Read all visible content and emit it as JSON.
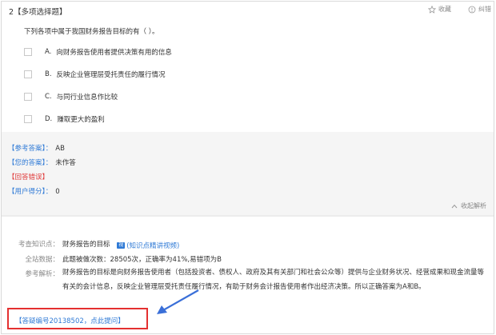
{
  "question": {
    "title": "2【多项选择题】",
    "stem": "下列各项中属于我国财务报告目标的有（  ）。",
    "favorite_label": "收藏",
    "report_error_label": "纠错",
    "options": [
      {
        "letter": "A.",
        "text": "向财务报告使用者提供决策有用的信息"
      },
      {
        "letter": "B.",
        "text": "反映企业管理层受托责任的履行情况"
      },
      {
        "letter": "C.",
        "text": "与同行业信息作比较"
      },
      {
        "letter": "D.",
        "text": "赚取更大的盈利"
      }
    ]
  },
  "answer": {
    "reference_label": "【参考答案】：",
    "reference_value": "AB",
    "yours_label": "【您的答案】：",
    "yours_value": "未作答",
    "wrong_label": "【回答错误】",
    "score_label": "【用户得分】：",
    "score_value": "0",
    "collapse_label": "收起解析"
  },
  "analysis": {
    "knowledge_label": "考查知识点：",
    "knowledge_value": "财务报告的目标",
    "video_badge": "视",
    "video_link": "(知识点精讲视频)",
    "stats_label": "全站数据：",
    "stats_value": "此题被做次数：28505次，正确率为41%,易错项为B",
    "explain_label": "参考解析：",
    "explain_value": "财务报告的目标是向财务报告使用者（包括投资者、债权人、政府及其有关部门和社会公众等）提供与企业财务状况、经营成果和现金流量等有关的会计信息，反映企业管理层受托责任履行情况，有助于财务会计报告使用者作出经济决策。所以正确答案为A和B。",
    "ask_link": "【答疑编号20138502，点此提问】"
  }
}
